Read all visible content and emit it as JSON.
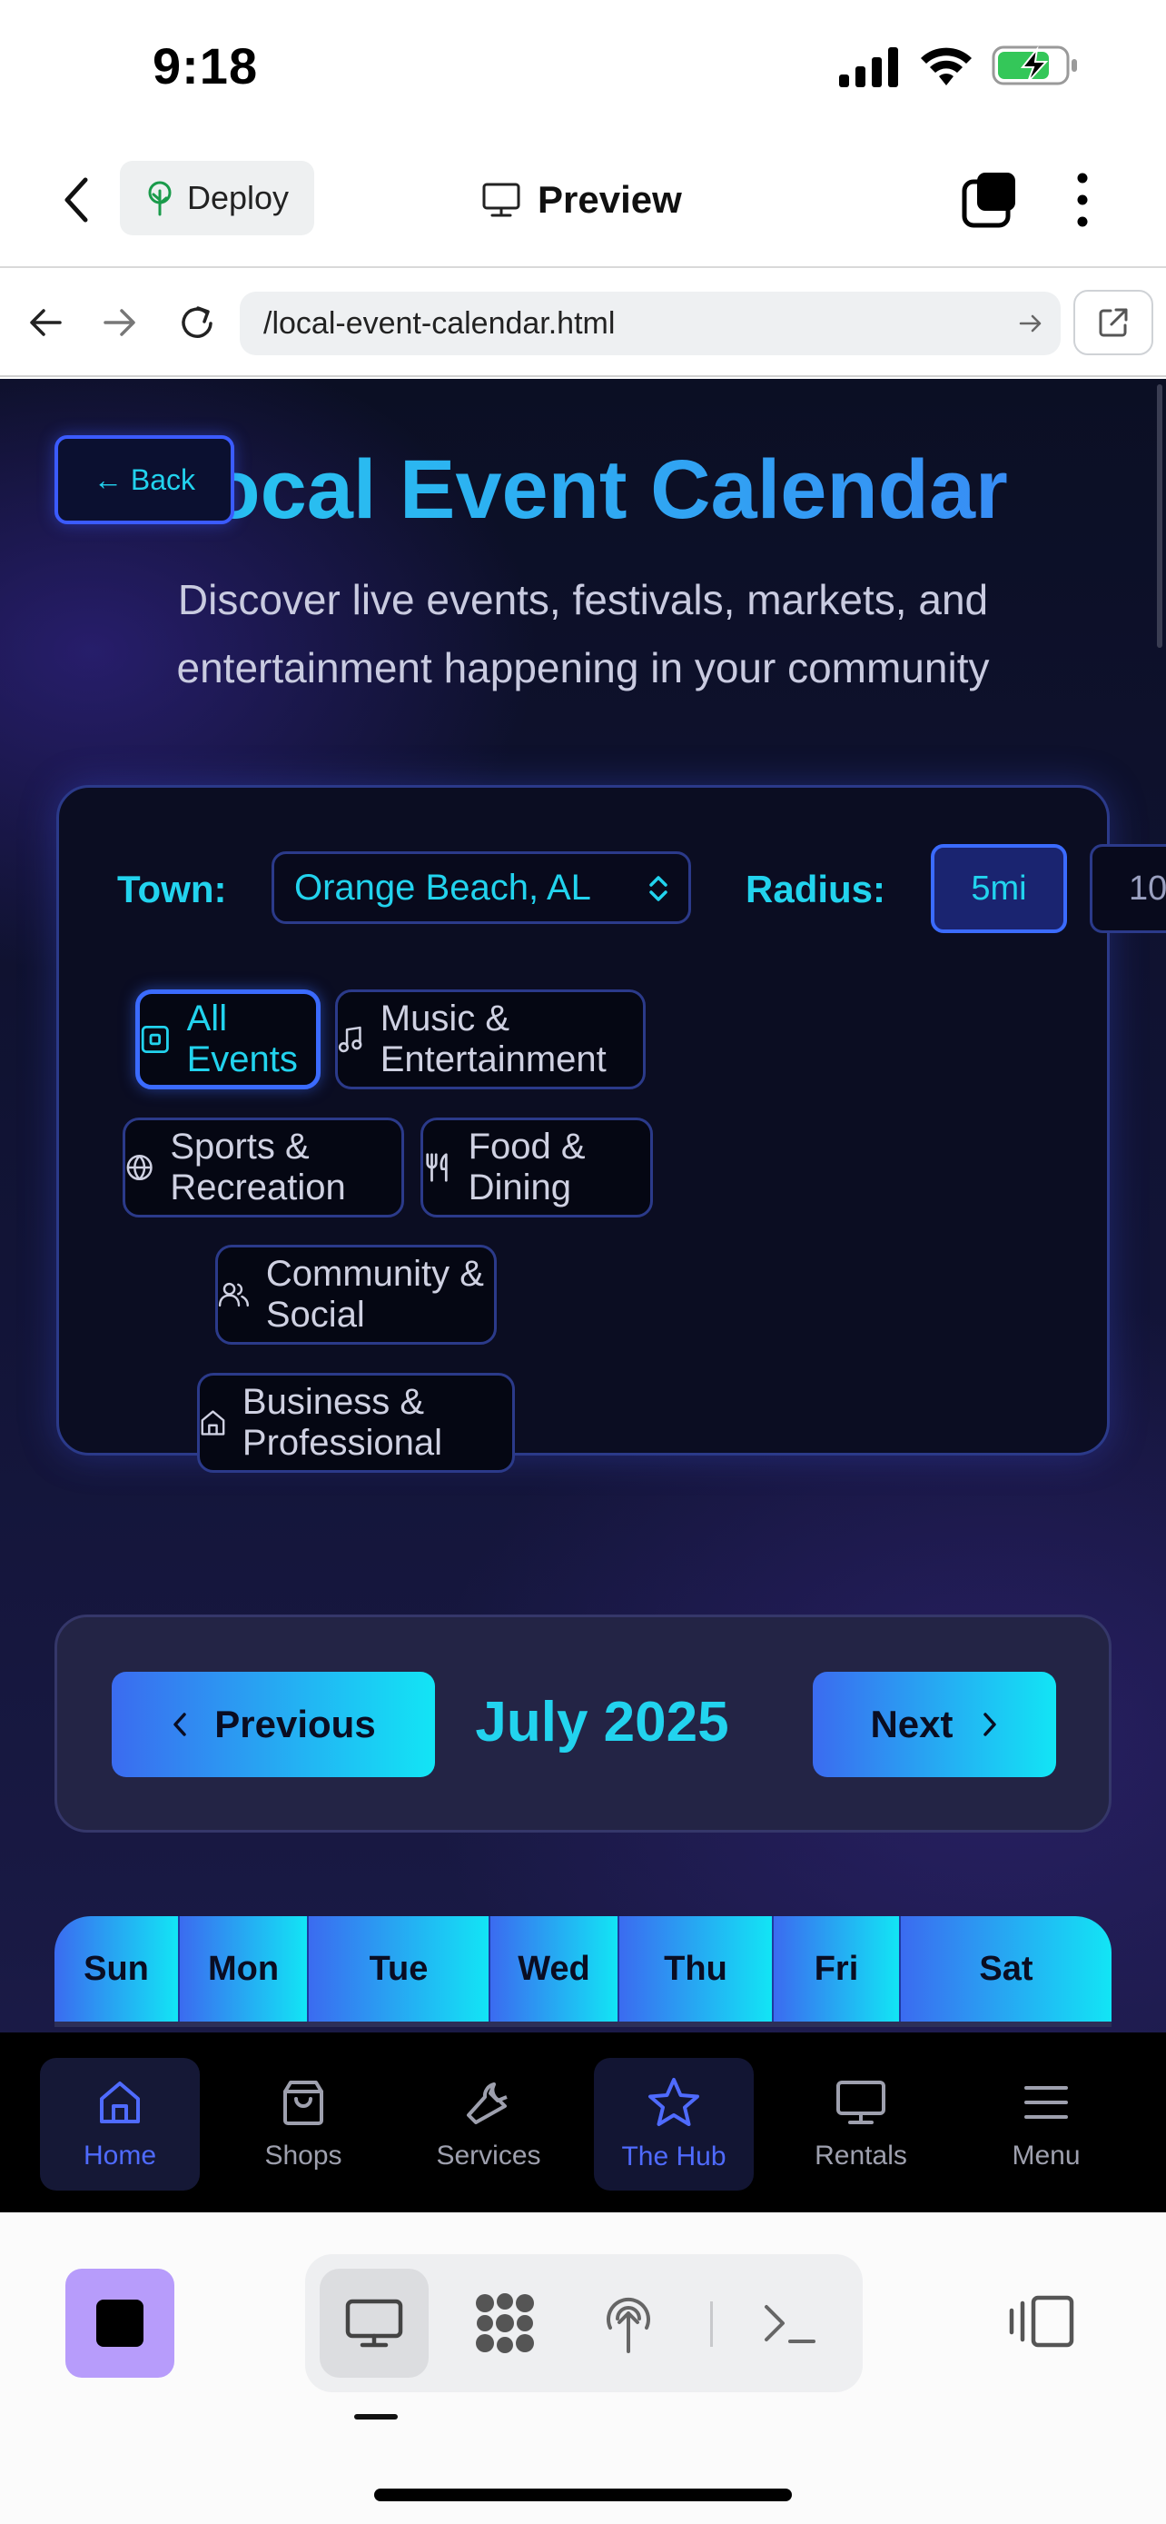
{
  "status_bar": {
    "time": "9:18"
  },
  "app_header": {
    "deploy_label": "Deploy",
    "preview_label": "Preview"
  },
  "browser": {
    "url": "/local-event-calendar.html"
  },
  "page": {
    "back_label": "← Back",
    "title": "Local Event Calendar",
    "subtitle": "Discover live events, festivals, markets, and entertainment happening in your community",
    "filters": {
      "town_label": "Town:",
      "town_value": "Orange Beach, AL",
      "radius_label": "Radius:",
      "radius_options": [
        "5mi",
        "10"
      ],
      "categories": [
        {
          "label": "All Events",
          "icon": "calendar-square-icon",
          "active": true
        },
        {
          "label": "Music & Entertainment",
          "icon": "music-note-icon",
          "active": false
        },
        {
          "label": "Sports & Recreation",
          "icon": "globe-icon",
          "active": false
        },
        {
          "label": "Food & Dining",
          "icon": "utensils-icon",
          "active": false
        },
        {
          "label": "Community & Social",
          "icon": "users-icon",
          "active": false
        },
        {
          "label": "Business & Professional",
          "icon": "building-icon",
          "active": false
        }
      ]
    },
    "month_nav": {
      "prev_label": "Previous",
      "month": "July 2025",
      "next_label": "Next"
    },
    "weekdays": [
      "Sun",
      "Mon",
      "Tue",
      "Wed",
      "Thu",
      "Fri",
      "Sat"
    ]
  },
  "site_nav": [
    {
      "label": "Home",
      "icon": "home-icon",
      "selected": true
    },
    {
      "label": "Shops",
      "icon": "shopping-bag-icon",
      "selected": false
    },
    {
      "label": "Services",
      "icon": "wrench-icon",
      "selected": false
    },
    {
      "label": "The Hub",
      "icon": "star-icon",
      "selected": true
    },
    {
      "label": "Rentals",
      "icon": "monitor-icon",
      "selected": false
    },
    {
      "label": "Menu",
      "icon": "hamburger-icon",
      "selected": false
    }
  ],
  "colors": {
    "accent_cyan": "#22d3ee",
    "accent_blue": "#3b6bff",
    "page_bg": "#0b0f24",
    "stop_button": "#b79cfb"
  }
}
